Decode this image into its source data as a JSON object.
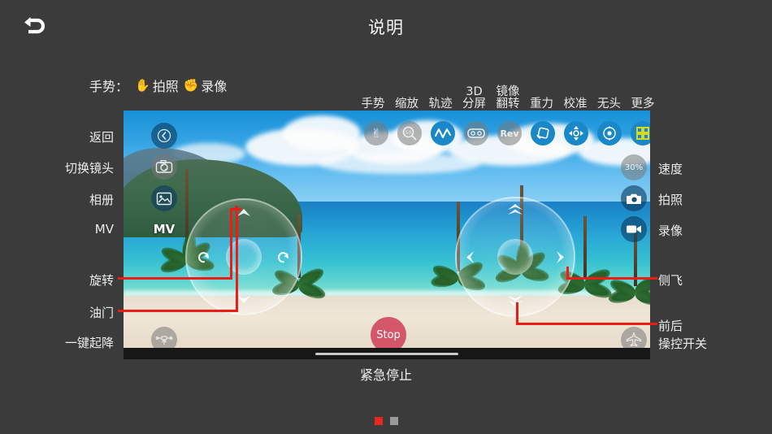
{
  "header": {
    "title": "说明",
    "back_icon": "back-arrow-icon"
  },
  "gesture_legend": {
    "label": "手势：",
    "items": [
      {
        "icon": "open-palm-icon",
        "glyph": "✋",
        "text": "拍照"
      },
      {
        "icon": "fist-icon",
        "glyph": "✊",
        "text": "录像"
      }
    ]
  },
  "top_labels": [
    {
      "line1": "",
      "line2": "手势"
    },
    {
      "line1": "",
      "line2": "缩放"
    },
    {
      "line1": "",
      "line2": "轨迹"
    },
    {
      "line1": "3D",
      "line2": "分屏"
    },
    {
      "line1": "镜像",
      "line2": "翻转"
    },
    {
      "line1": "",
      "line2": "重力"
    },
    {
      "line1": "",
      "line2": "校准"
    },
    {
      "line1": "",
      "line2": "无头"
    },
    {
      "line1": "",
      "line2": "更多"
    }
  ],
  "toolbar": [
    {
      "name": "gesture-toolbar-button",
      "icon": "hand-gesture-icon",
      "glyph": "✌",
      "style": "grey"
    },
    {
      "name": "zoom-toolbar-button",
      "icon": "zoom-magnifier-icon",
      "glyph": "",
      "label": "50",
      "style": "grey"
    },
    {
      "name": "trajectory-toolbar-button",
      "icon": "waveform-icon",
      "glyph": "∿",
      "style": "blue"
    },
    {
      "name": "split-screen-toolbar-button",
      "icon": "vr-goggles-icon",
      "glyph": "",
      "style": "grey"
    },
    {
      "name": "mirror-flip-toolbar-button",
      "icon": "rev-icon",
      "glyph": "Rev",
      "style": "grey"
    },
    {
      "name": "gravity-toolbar-button",
      "icon": "gravity-rotate-icon",
      "glyph": "",
      "style": "blue"
    },
    {
      "name": "calibration-toolbar-button",
      "icon": "crosshair-icon",
      "glyph": "",
      "style": "blue"
    },
    {
      "name": "headless-toolbar-button",
      "icon": "target-icon",
      "glyph": "",
      "style": "blue"
    },
    {
      "name": "more-toolbar-button",
      "icon": "grid-more-icon",
      "glyph": "",
      "style": "blue"
    }
  ],
  "left_controls": [
    {
      "name": "back-button",
      "icon": "chevron-left-icon",
      "label": "返回",
      "style": "dark",
      "glyph": "‹"
    },
    {
      "name": "switch-camera-button",
      "icon": "camera-switch-icon",
      "label": "切换镜头",
      "style": "grey",
      "glyph": ""
    },
    {
      "name": "album-button",
      "icon": "photo-album-icon",
      "label": "相册",
      "style": "dark",
      "glyph": ""
    },
    {
      "name": "mv-button",
      "icon": "mv-icon",
      "label": "MV",
      "style": "none",
      "glyph": "MV"
    },
    {
      "name": "takeoff-landing-button",
      "icon": "drone-takeoff-icon",
      "label": "一键起降",
      "style": "grey",
      "glyph": ""
    }
  ],
  "right_controls": [
    {
      "name": "speed-button",
      "icon": "speed-percent-icon",
      "label": "速度",
      "value": "30%",
      "style": "grey"
    },
    {
      "name": "photo-button",
      "icon": "camera-icon",
      "label": "拍照",
      "value": "",
      "style": "dark"
    },
    {
      "name": "record-button",
      "icon": "video-camera-icon",
      "label": "录像",
      "value": "",
      "style": "dark"
    },
    {
      "name": "control-switch-button",
      "icon": "aircraft-icon",
      "label": "操控开关",
      "value": "",
      "style": "grey"
    }
  ],
  "callouts_left": [
    {
      "name": "rotate-callout",
      "label": "旋转"
    },
    {
      "name": "throttle-callout",
      "label": "油门"
    }
  ],
  "callouts_right": [
    {
      "name": "side-flight-callout",
      "label": "侧飞"
    },
    {
      "name": "forward-back-callout",
      "label": "前后"
    }
  ],
  "joysticks": {
    "left": {
      "name": "left-joystick",
      "up_icon": "chevron-up-icon",
      "down_icon": "chevron-down-icon",
      "left_icon": "rotate-left-icon",
      "right_icon": "rotate-right-icon"
    },
    "right": {
      "name": "right-joystick",
      "up_icon": "double-chevron-up-icon",
      "down_icon": "double-chevron-down-icon",
      "left_icon": "arrow-left-icon",
      "right_icon": "arrow-right-icon"
    }
  },
  "stop_button": {
    "name": "emergency-stop-button",
    "label": "Stop",
    "caption": "紧急停止"
  },
  "pagination": {
    "dots": [
      {
        "active": true,
        "color": "#e8281a"
      },
      {
        "active": false,
        "color": "#9a9a9a"
      }
    ]
  },
  "colors": {
    "background": "#3b3b3b",
    "accent_red": "#ee1b16",
    "accent_blue": "#1a88c8",
    "more_yellow": "#d8d823"
  }
}
